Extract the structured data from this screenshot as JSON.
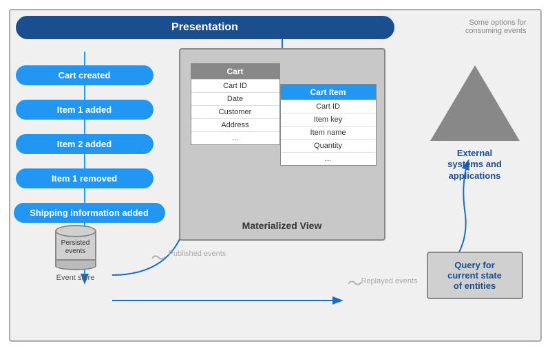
{
  "diagram": {
    "title": "Presentation",
    "options_text": "Some options for\nconsuming events",
    "events": [
      {
        "label": "Cart created"
      },
      {
        "label": "Item 1 added"
      },
      {
        "label": "Item 2 added"
      },
      {
        "label": "Item 1 removed"
      },
      {
        "label": "Shipping information added"
      }
    ],
    "materialized_view_label": "Materialized View",
    "cart_table": {
      "header": "Cart",
      "rows": [
        "Cart ID",
        "Date",
        "Customer",
        "Address",
        "..."
      ]
    },
    "cart_item_table": {
      "header": "Cart Item",
      "rows": [
        "Cart ID",
        "Item key",
        "Item name",
        "Quantity",
        "..."
      ]
    },
    "external_systems": {
      "label": "External\nsystems and\napplications"
    },
    "event_store": {
      "cylinder_label": "Persisted\nevents",
      "store_label": "Event store"
    },
    "published_events_label": "Published events",
    "replayed_events_label": "Replayed events",
    "query_box": {
      "label": "Query for\ncurrent state\nof entities"
    }
  }
}
